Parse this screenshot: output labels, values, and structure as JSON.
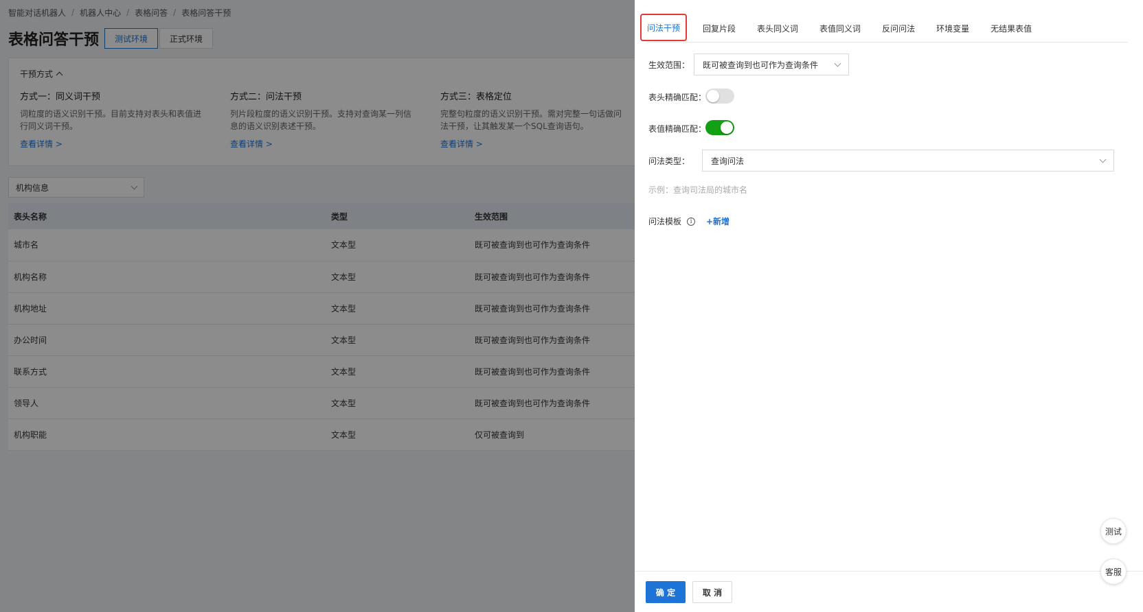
{
  "breadcrumb": [
    "智能对话机器人",
    "机器人中心",
    "表格问答",
    "表格问答干预"
  ],
  "page_title": "表格问答干预",
  "env_tabs": [
    "测试环境",
    "正式环境"
  ],
  "intervention": {
    "header": "干预方式",
    "methods": [
      {
        "name": "方式一：同义词干预",
        "desc": "词粒度的语义识别干预。目前支持对表头和表值进行同义词干预。",
        "link": "查看详情 >"
      },
      {
        "name": "方式二：问法干预",
        "desc": "列片段粒度的语义识别干预。支持对查询某一列信息的语义识别表述干预。",
        "link": "查看详情 >"
      },
      {
        "name": "方式三：表格定位",
        "desc": "完整句粒度的语义识别干预。需对完整一句话做问法干预，让其触发某一个SQL查询语句。",
        "link": "查看详情 >"
      }
    ]
  },
  "table_select": "机构信息",
  "table": {
    "headers": [
      "表头名称",
      "类型",
      "生效范围"
    ],
    "rows": [
      [
        "城市名",
        "文本型",
        "既可被查询到也可作为查询条件"
      ],
      [
        "机构名称",
        "文本型",
        "既可被查询到也可作为查询条件"
      ],
      [
        "机构地址",
        "文本型",
        "既可被查询到也可作为查询条件"
      ],
      [
        "办公时间",
        "文本型",
        "既可被查询到也可作为查询条件"
      ],
      [
        "联系方式",
        "文本型",
        "既可被查询到也可作为查询条件"
      ],
      [
        "领导人",
        "文本型",
        "既可被查询到也可作为查询条件"
      ],
      [
        "机构职能",
        "文本型",
        "仅可被查询到"
      ]
    ]
  },
  "drawer": {
    "tabs": [
      "问法干预",
      "回复片段",
      "表头同义词",
      "表值同义词",
      "反问问法",
      "环境变量",
      "无结果表值"
    ],
    "active_tab": "问法干预",
    "scope_label": "生效范围：",
    "scope_value": "既可被查询到也可作为查询条件",
    "header_exact_label": "表头精确匹配：",
    "header_exact_on": false,
    "value_exact_label": "表值精确匹配：",
    "value_exact_on": true,
    "qtype_label": "问法类型：",
    "qtype_value": "查询问法",
    "example": "示例：查询司法局的城市名",
    "template_label": "问法模板",
    "add_label": "+新增",
    "ok_label": "确 定",
    "cancel_label": "取 消"
  },
  "float": {
    "test": "测试",
    "service": "客服"
  },
  "colors": {
    "primary": "#1e73d6",
    "switch_on": "#14a014",
    "highlight": "#e53935"
  }
}
